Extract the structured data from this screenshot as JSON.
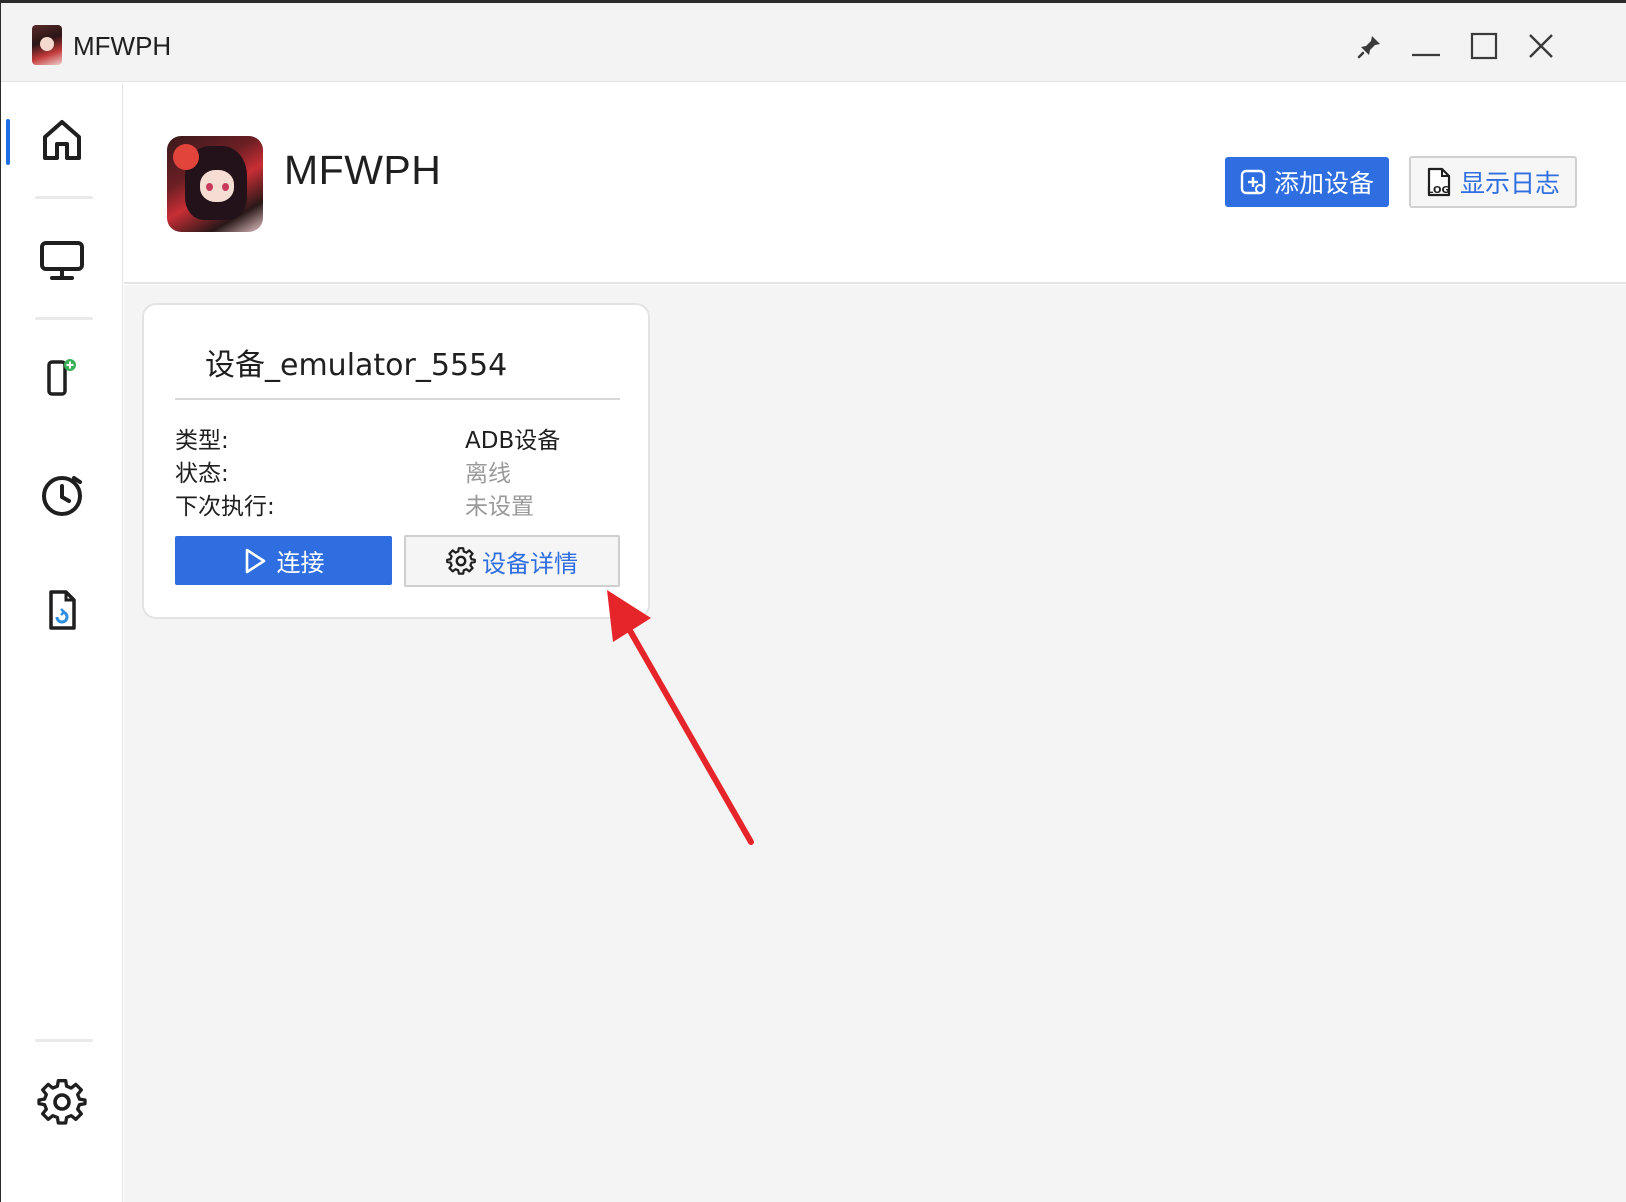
{
  "window": {
    "title": "MFWPH"
  },
  "titlebar": {
    "icons": [
      "app-avatar-icon",
      "pin-icon",
      "minimize-icon",
      "maximize-icon",
      "close-icon"
    ]
  },
  "sidebar": {
    "items": [
      {
        "icon": "home-icon",
        "active": true
      },
      {
        "icon": "monitor-icon",
        "active": false
      },
      {
        "icon": "add-device-icon",
        "active": false
      },
      {
        "icon": "clock-icon",
        "active": false
      },
      {
        "icon": "document-refresh-icon",
        "active": false
      },
      {
        "icon": "settings-gear-icon",
        "active": false
      }
    ],
    "accent": "#1f6fe5"
  },
  "header": {
    "app_name": "MFWPH",
    "add_device_label": "添加设备",
    "show_log_label": "显示日志",
    "log_icon_text": "LOG"
  },
  "device_card": {
    "title": "设备_emulator_5554",
    "rows": [
      {
        "label": "类型:",
        "value": "ADB设备"
      },
      {
        "label": "状态:",
        "value": "离线"
      },
      {
        "label": "下次执行:",
        "value": "未设置"
      }
    ],
    "connect_label": "连接",
    "details_label": "设备详情"
  },
  "colors": {
    "primary": "#2e6ee0",
    "annotation_arrow": "#e5252a",
    "muted_text": "#9a9a9a"
  }
}
